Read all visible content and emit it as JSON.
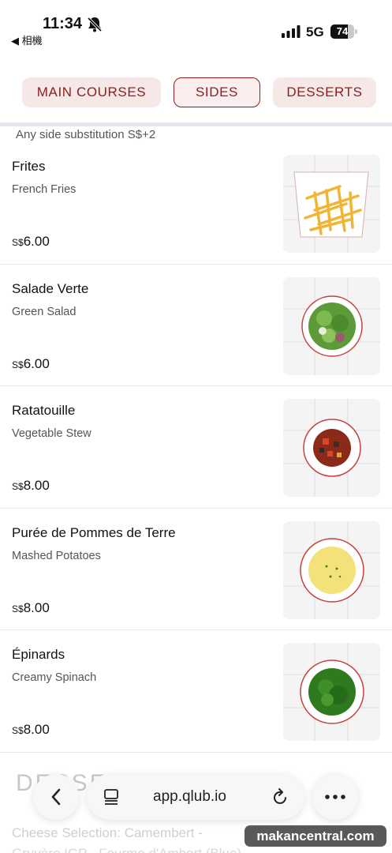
{
  "status": {
    "time": "11:34",
    "back_app": "◀ 相機",
    "network": "5G",
    "battery_level": "74",
    "battery_fraction": 0.74
  },
  "tabs": [
    {
      "label": "MAIN COURSES",
      "active": false
    },
    {
      "label": "SIDES",
      "active": true
    },
    {
      "label": "DESSERTS",
      "active": false
    }
  ],
  "colors": {
    "accent": "#8a1f1f",
    "tab_bg": "#f5e8e6"
  },
  "section_note": "Any side substitution S$+2",
  "items": [
    {
      "name": "Frites",
      "description": "French Fries",
      "currency": "S$",
      "price": "6.00",
      "photo": "fries"
    },
    {
      "name": "Salade Verte",
      "description": "Green Salad",
      "currency": "S$",
      "price": "6.00",
      "photo": "salad"
    },
    {
      "name": "Ratatouille",
      "description": "Vegetable Stew",
      "currency": "S$",
      "price": "8.00",
      "photo": "ratatouille"
    },
    {
      "name": "Purée de Pommes de Terre",
      "description": "Mashed Potatoes",
      "currency": "S$",
      "price": "8.00",
      "photo": "mashed"
    },
    {
      "name": "Épinards",
      "description": "Creamy Spinach",
      "currency": "S$",
      "price": "8.00",
      "photo": "spinach"
    }
  ],
  "next_section": {
    "heading": "DESSERTS",
    "line1": "Cheese Selection: Camembert -",
    "line2": "Gruyère IGP - Fourme d'Ambert (Blue)"
  },
  "browser": {
    "url": "app.qlub.io"
  },
  "watermark": "makancentral.com"
}
